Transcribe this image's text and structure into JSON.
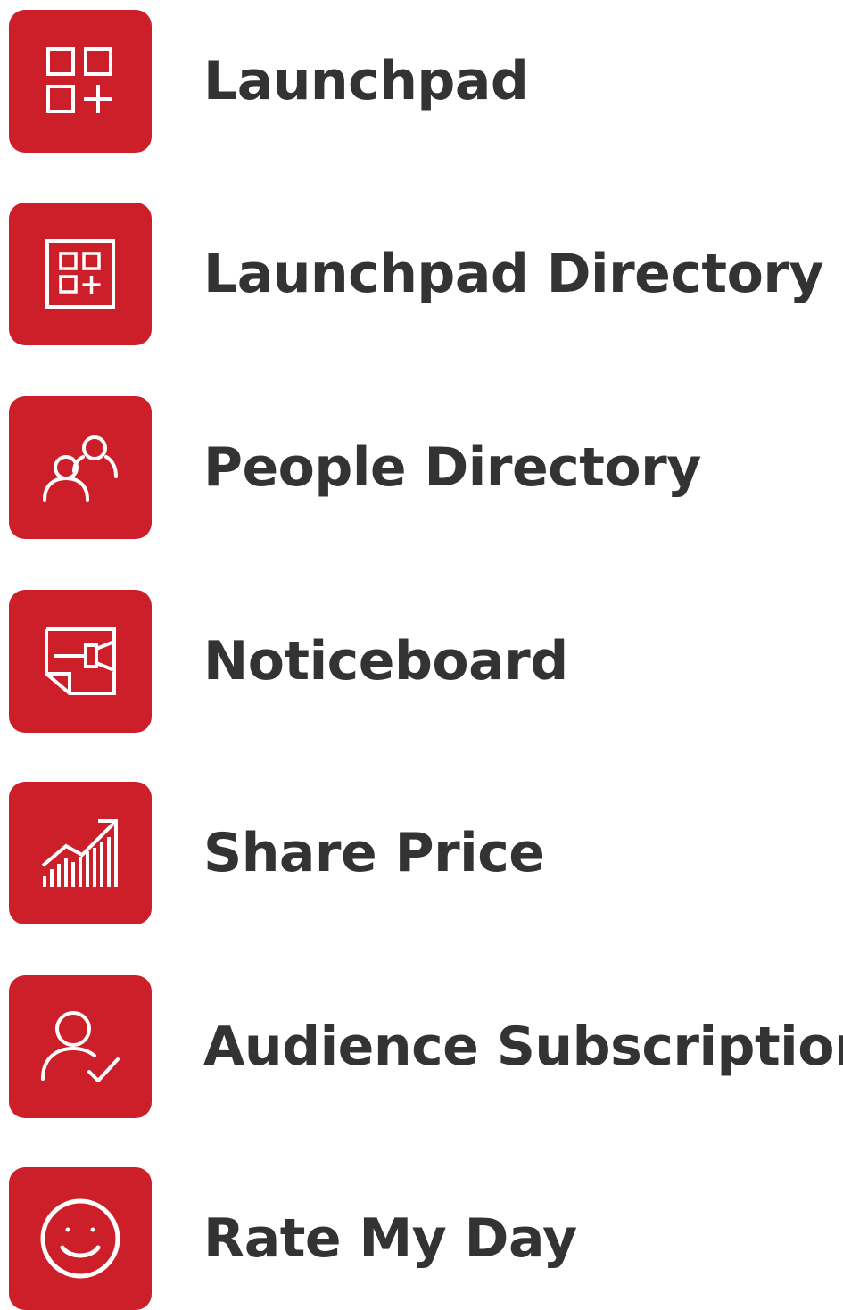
{
  "colors": {
    "tile_background": "#cd1f2a",
    "icon": "#ffffff",
    "label_text": "#333333"
  },
  "apps": [
    {
      "label": "Launchpad",
      "icon": "launchpad-grid-plus-icon"
    },
    {
      "label": "Launchpad Directory",
      "icon": "launchpad-directory-icon"
    },
    {
      "label": "People Directory",
      "icon": "people-group-icon"
    },
    {
      "label": "Noticeboard",
      "icon": "noticeboard-pin-icon"
    },
    {
      "label": "Share Price",
      "icon": "rising-chart-icon"
    },
    {
      "label": "Audience Subscription",
      "icon": "person-check-icon"
    },
    {
      "label": "Rate My Day",
      "icon": "smiley-face-icon"
    }
  ]
}
